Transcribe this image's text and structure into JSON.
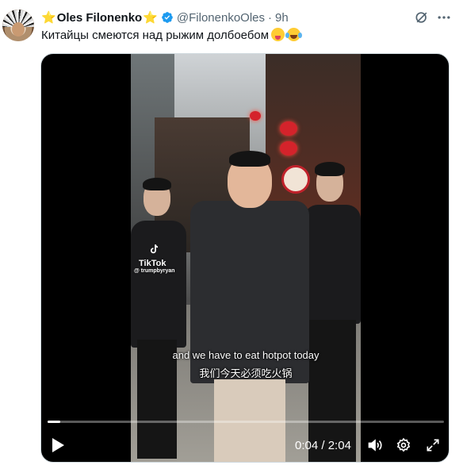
{
  "author": {
    "display_name": "Oles Filonenko",
    "star_left": "⭐",
    "star_right": "⭐",
    "handle": "@FilonenkoOles",
    "separator": "·",
    "time": "9h",
    "verified_color": "#1d9bf0"
  },
  "tweet": {
    "text": "Китайцы смеются над рыжим долбоебом"
  },
  "icons": [
    "verified-badge-icon",
    "grok-icon",
    "more-icon",
    "play-icon",
    "volume-icon",
    "settings-icon",
    "fullscreen-icon"
  ],
  "video": {
    "watermark_brand": "TikTok",
    "watermark_user": "@ trumpbyryan",
    "subtitle_en": "and we have to eat hotpot today",
    "subtitle_zh": "我们今天必须吃火锅",
    "current_time": "0:04",
    "time_separator": "/",
    "duration": "2:04",
    "progress_fraction": 0.032,
    "accent_color": "#ffffff"
  }
}
